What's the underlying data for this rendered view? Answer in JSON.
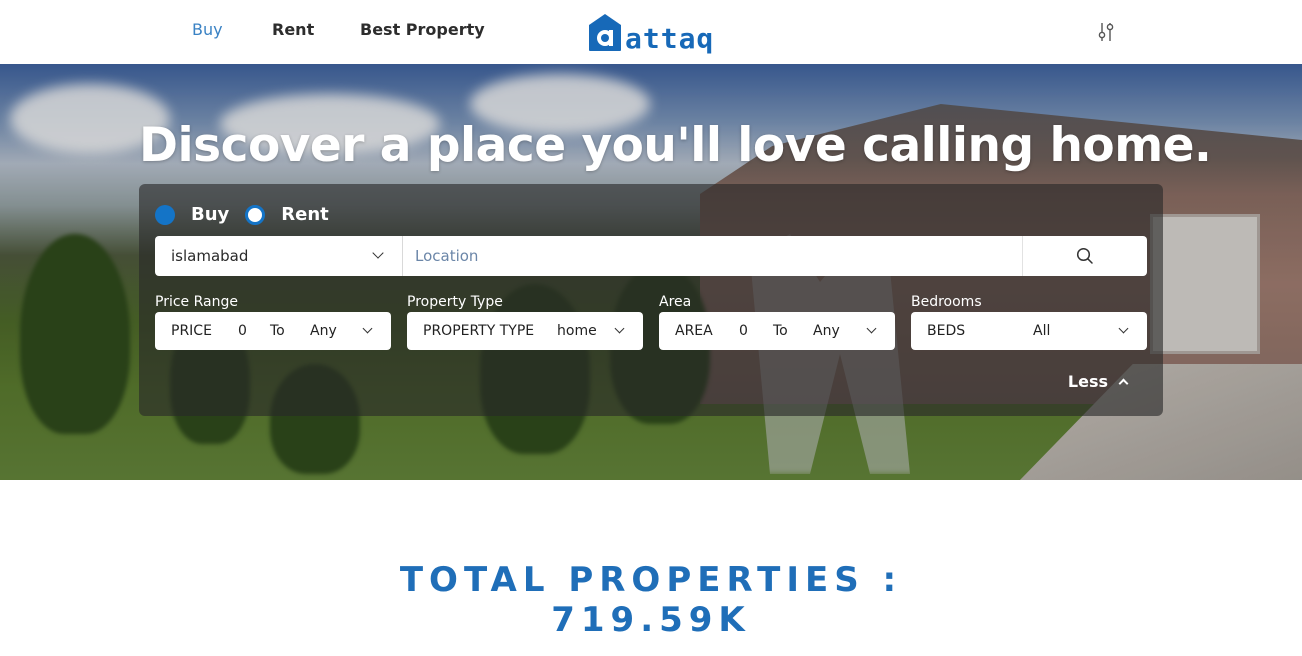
{
  "nav": {
    "links": [
      "Buy",
      "Rent",
      "Best Property"
    ],
    "logo_text": "attaq"
  },
  "hero": {
    "title": "Discover a place you'll love calling home."
  },
  "search": {
    "mode_buy": "Buy",
    "mode_rent": "Rent",
    "selected_mode": "Buy",
    "city": "islamabad",
    "location_placeholder": "Location",
    "filters": {
      "price": {
        "label": "Price Range",
        "prefix": "PRICE",
        "min": "0",
        "to": "To",
        "max": "Any"
      },
      "property_type": {
        "label": "Property Type",
        "prefix": "PROPERTY TYPE",
        "value": "home"
      },
      "area": {
        "label": "Area",
        "prefix": "AREA",
        "min": "0",
        "to": "To",
        "max": "Any"
      },
      "bedrooms": {
        "label": "Bedrooms",
        "prefix": "BEDS",
        "value": "All"
      }
    },
    "less_label": "Less"
  },
  "stats": {
    "line1": "TOTAL PROPERTIES :",
    "line2": "719.59K"
  },
  "colors": {
    "brand": "#1769b8",
    "active_nav": "#3a82c4",
    "radio": "#1474c7"
  }
}
